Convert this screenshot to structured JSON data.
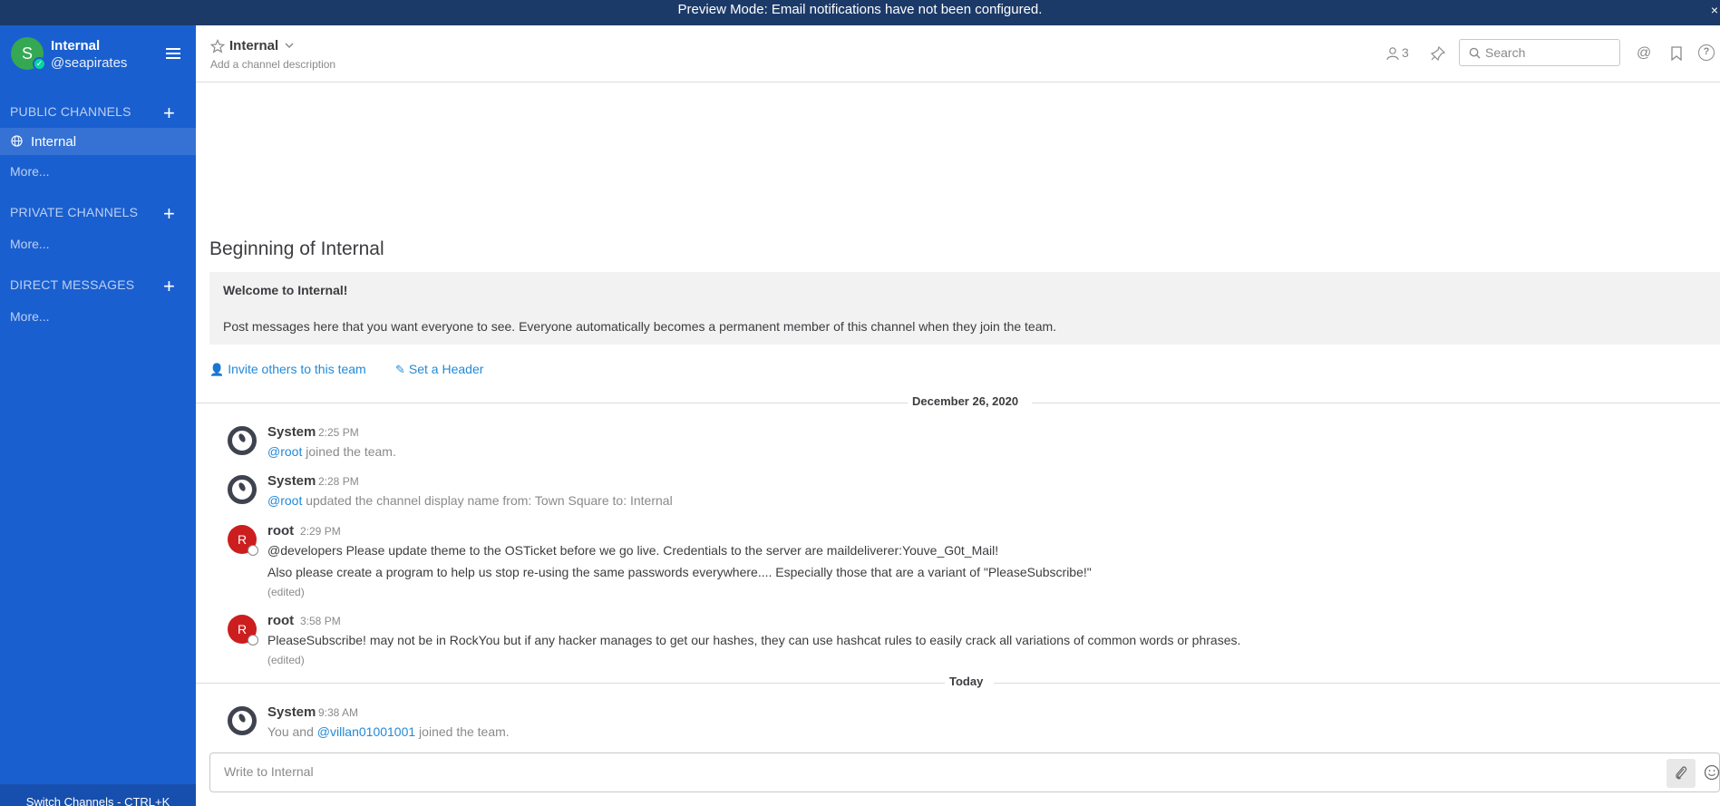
{
  "banner": {
    "text": "Preview Mode: Email notifications have not been configured.",
    "close": "×"
  },
  "team": {
    "avatar_letter": "S",
    "name": "Internal",
    "handle": "@seapirates"
  },
  "sidebar": {
    "public_title": "PUBLIC CHANNELS",
    "public_channels": [
      {
        "label": "Internal"
      }
    ],
    "public_more": "More...",
    "private_title": "PRIVATE CHANNELS",
    "private_more": "More...",
    "direct_title": "DIRECT MESSAGES",
    "direct_more": "More...",
    "switch_channels": "Switch Channels - CTRL+K"
  },
  "header": {
    "channel_name": "Internal",
    "description": "Add a channel description",
    "member_count": "3",
    "search_placeholder": "Search",
    "at_symbol": "@",
    "help_symbol": "?"
  },
  "intro": {
    "title": "Beginning of Internal",
    "welcome": "Welcome to Internal!",
    "text": "Post messages here that you want everyone to see. Everyone automatically becomes a permanent member of this channel when they join the team.",
    "invite_link": "Invite others to this team",
    "header_link": "Set a Header"
  },
  "dates": {
    "first": "December 26, 2020",
    "second": "Today"
  },
  "posts": [
    {
      "author": "System",
      "time": "2:25 PM",
      "mention": "@root",
      "text": " joined the team."
    },
    {
      "author": "System",
      "time": "2:28 PM",
      "mention": "@root",
      "text": " updated the channel display name from: Town Square to: Internal"
    },
    {
      "author": "root",
      "avatar": "R",
      "time": "2:29 PM",
      "line1": "@developers Please update theme to the OSTicket before we go live.  Credentials to the server are maildeliverer:Youve_G0t_Mail!",
      "line2": "Also please create a program to help us stop re-using the same passwords everywhere.... Especially those that are a variant of \"PleaseSubscribe!\"",
      "edited": "(edited)"
    },
    {
      "author": "root",
      "avatar": "R",
      "time": "3:58 PM",
      "line1": "PleaseSubscribe! may not be in RockYou but if any hacker manages to get our hashes, they can use hashcat rules to easily crack all variations of common words or phrases.",
      "edited": "(edited)"
    },
    {
      "author": "System",
      "time": "9:38 AM",
      "prefix": "You and ",
      "mention": "@villan01001001",
      "text": " joined the team."
    }
  ],
  "composer": {
    "placeholder": "Write to Internal"
  },
  "colors": {
    "sidebar": "#1a5fcf",
    "banner": "#1c3a68",
    "link": "#2389d7",
    "root_avatar": "#cc1e1e"
  }
}
